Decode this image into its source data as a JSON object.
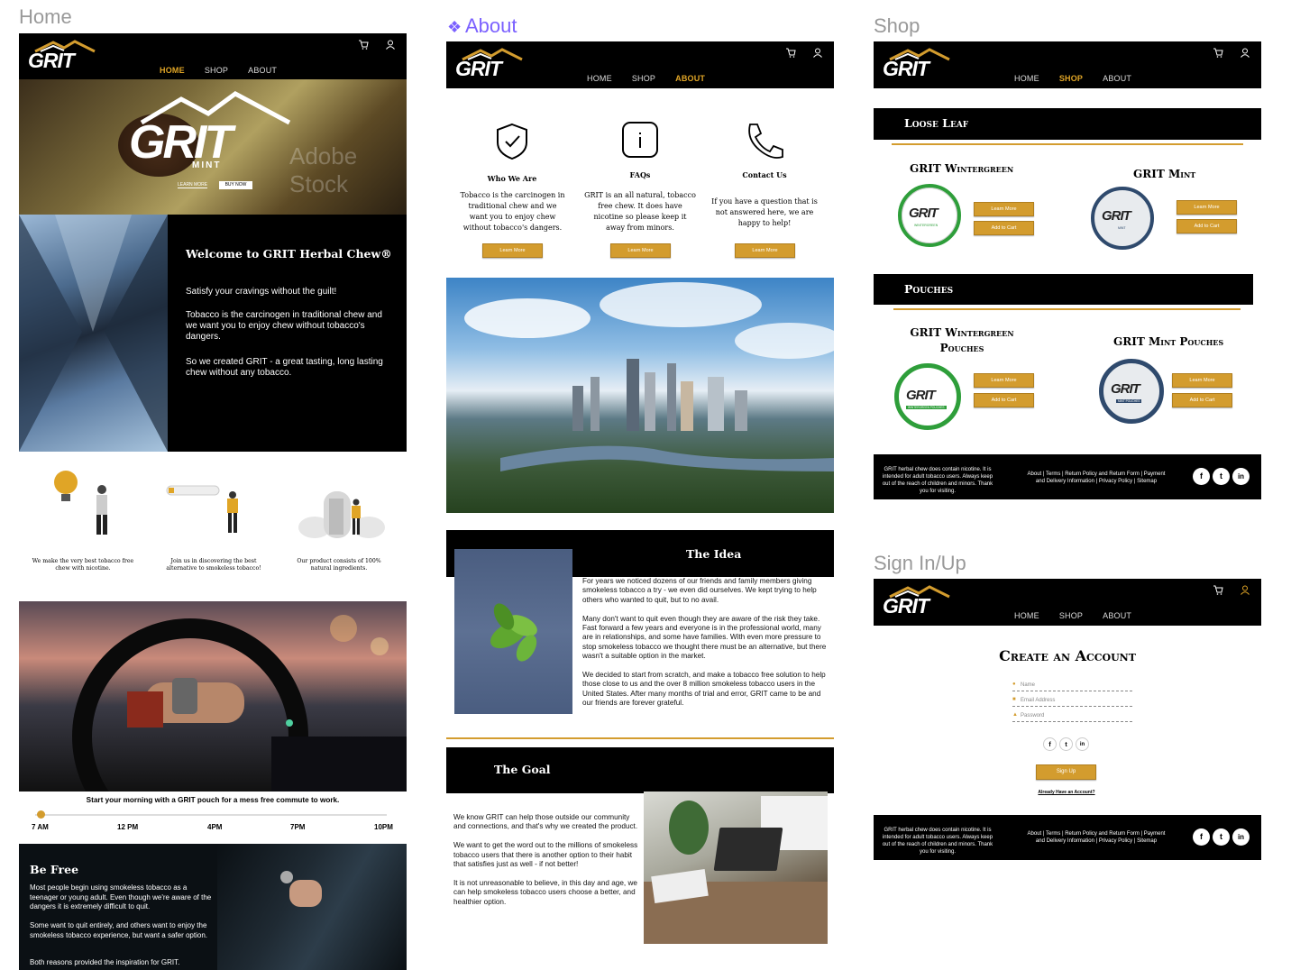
{
  "labels": {
    "home": "Home",
    "about": "About",
    "shop": "Shop",
    "signin": "Sign In/Up"
  },
  "nav": {
    "home": "HOME",
    "shop": "SHOP",
    "about": "ABOUT"
  },
  "brand": {
    "logo": "GRIT",
    "hero_logo": "GRIT",
    "hero_sub": "MINT",
    "watermark": "Adobe Stock"
  },
  "colors": {
    "gold": "#d39c2e",
    "green": "#2e9e3a",
    "navy": "#2f4a6d",
    "accent": "#7b61ff"
  },
  "icons": {
    "cart": "cart-icon",
    "user": "user-icon",
    "shield": "shield-check-icon",
    "info": "info-icon",
    "phone": "phone-icon"
  },
  "home": {
    "hero": {
      "learn_more": "LEARN MORE",
      "buy_now": "BUY NOW"
    },
    "welcome": {
      "title": "Welcome to GRIT Herbal Chew®",
      "p1": "Satisfy your cravings without the guilt!",
      "p2": "Tobacco is the carcinogen in traditional chew and we want you to enjoy chew without tobacco's dangers.",
      "p3": "So we created GRIT - a great tasting, long lasting chew without any tobacco."
    },
    "features": [
      {
        "text": "We make the very best tobacco free chew with nicotine."
      },
      {
        "text": "Join us in discovering the best alternative to smokeless tobacco!"
      },
      {
        "text": "Our product consists of 100% natural ingredients."
      }
    ],
    "commute": {
      "caption": "Start your morning with a GRIT pouch for a mess free commute to work.",
      "times": [
        "7 AM",
        "12 PM",
        "4PM",
        "7PM",
        "10PM"
      ],
      "progress": 0.03
    },
    "befree": {
      "title": "Be Free",
      "p1": "Most people begin using smokeless tobacco as a teenager or young adult. Even though we're aware of the dangers it is extremely difficult to quit.",
      "p2": "Some want to quit entirely, and others want to enjoy the smokeless tobacco experience, but want a safer option.",
      "p3": "Both reasons provided the inspiration for GRIT."
    }
  },
  "about": {
    "cards": [
      {
        "title": "Who We Are",
        "text": "Tobacco is the carcinogen in traditional chew and we want you to enjoy chew without tobacco's dangers.",
        "button": "Learn More"
      },
      {
        "title": "FAQs",
        "text": "GRIT is an all natural, tobacco free chew. It does have nicotine so please keep it away from minors.",
        "button": "Learn More"
      },
      {
        "title": "Contact Us",
        "text": "If you have a question that is not answered here, we are happy to help!",
        "button": "Learn More"
      }
    ],
    "idea": {
      "title": "The Idea",
      "p1": "For years we noticed dozens of our friends and family members giving smokeless tobacco a try - we even did ourselves. We kept trying to help others who wanted to quit, but to no avail.",
      "p2": "Many don't want to quit even though they are aware of the risk they take. Fast forward a few years and everyone is in the professional world, many are in relationships, and some have families. With even more pressure to stop smokeless tobacco we thought there must be an alternative, but there wasn't a suitable option in the market.",
      "p3": "We decided to start from scratch, and make a tobacco free solution to help those close to us and the over 8 million smokeless tobacco users in the United States. After many months of trial and error, GRIT came to be and our friends are forever grateful."
    },
    "goal": {
      "title": "The Goal",
      "p1": "We know GRIT can help those outside our community and connections, and that's why we created the product.",
      "p2": "We want to get the word out to the millions of smokeless tobacco users that there is another option to their habit that satisfies just as well - if not better!",
      "p3": "It is not unreasonable to believe, in this day and age, we can help smokeless tobacco users choose a better, and healthier option."
    }
  },
  "shop": {
    "loose_leaf": "Loose Leaf",
    "pouches": "Pouches",
    "products": [
      {
        "name": "GRIT Wintergreen",
        "learn": "Learn More",
        "cart": "Add to Cart"
      },
      {
        "name": "GRIT Mint",
        "learn": "Learn More",
        "cart": "Add to Cart"
      },
      {
        "name": "GRIT Wintergreen Pouches",
        "learn": "Learn More",
        "cart": "Add to Cart"
      },
      {
        "name": "GRIT Mint Pouches",
        "learn": "Learn More",
        "cart": "Add to Cart"
      }
    ],
    "tin_logo": "GRIT",
    "tin_sub_w": "WINTERGREEN",
    "tin_sub_m": "MINT",
    "tin_sub_wp": "WINTERGREEN POUCHES",
    "tin_sub_mp": "MINT POUCHES"
  },
  "footer": {
    "disclaimer": "GRIT herbal chew does contain nicotine. It is intended for adult tobacco users. Always keep out of the reach of children and minors. Thank you for visiting.",
    "links": "About | Terms | Return Policy and Return Form | Payment and Delivery Information | Privacy Policy | Sitemap",
    "social": [
      "f",
      "t",
      "in"
    ]
  },
  "signup": {
    "title": "Create an Account",
    "name_placeholder": "Name",
    "email_placeholder": "Email Address",
    "password_placeholder": "Password",
    "button": "Sign Up",
    "already": "Already Have an Account?"
  }
}
